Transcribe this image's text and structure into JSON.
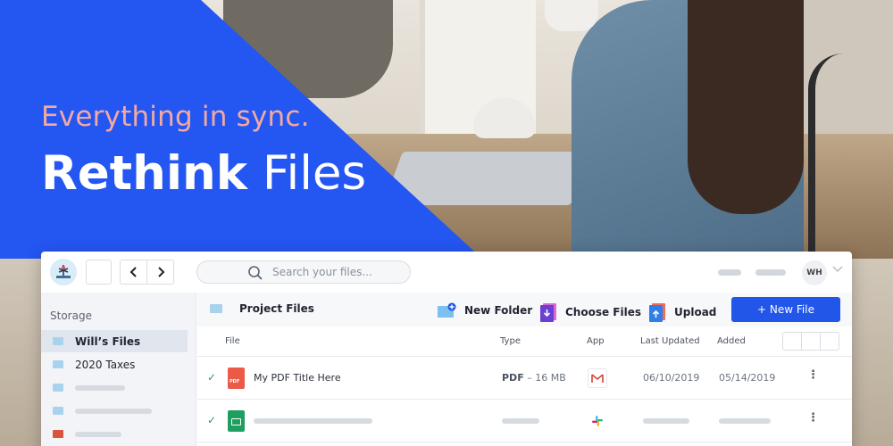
{
  "hero": {
    "tagline": "Everything in sync.",
    "headline_bold": "Rethink",
    "headline_light": "Files",
    "accent_color": "#2456f2",
    "tagline_color": "#f4a9a0"
  },
  "topbar": {
    "back_icon": "chevron-left",
    "forward_icon": "chevron-right",
    "search_placeholder": "Search your files...",
    "avatar_initials": "WH"
  },
  "sidebar": {
    "title": "Storage",
    "items": [
      {
        "label": "Will’s Files",
        "active": true
      },
      {
        "label": "2020 Taxes",
        "active": false
      }
    ]
  },
  "toolbar": {
    "folder_label": "Project Files",
    "new_folder_label": "New Folder",
    "choose_files_label": "Choose Files",
    "upload_label": "Upload",
    "new_file_label": "+ New File"
  },
  "table": {
    "headers": {
      "file": "File",
      "type": "Type",
      "app": "App",
      "last_updated": "Last Updated",
      "added": "Added"
    },
    "rows": [
      {
        "name": "My PDF Title Here",
        "type": "PDF",
        "size": "– 16 MB",
        "app_icon": "gmail-icon",
        "last_updated": "06/10/2019",
        "added": "05/14/2019",
        "file_icon": "pdf-icon"
      }
    ]
  }
}
